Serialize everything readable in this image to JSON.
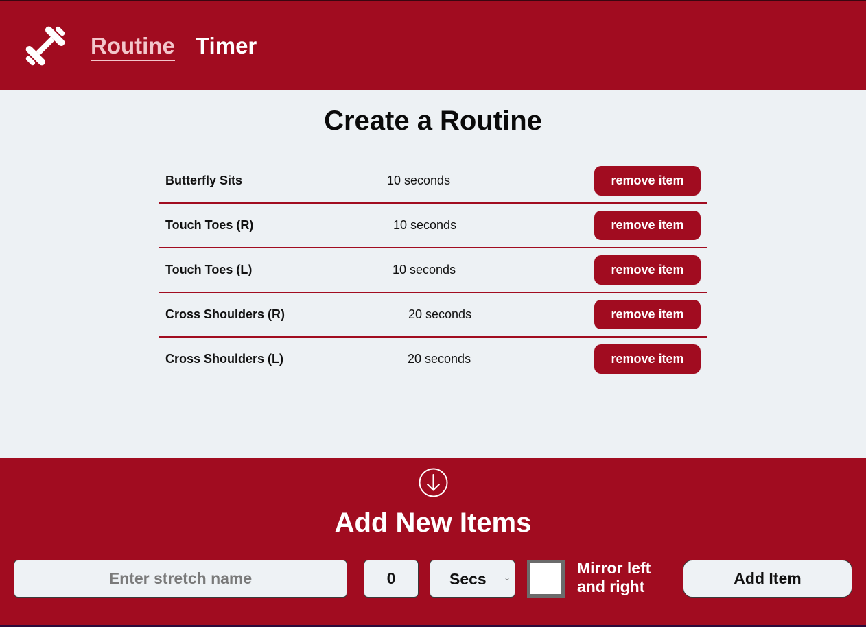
{
  "header": {
    "logo_icon": "dumbbell-icon",
    "nav": [
      {
        "label": "Routine",
        "active": true
      },
      {
        "label": "Timer",
        "active": false
      }
    ]
  },
  "main": {
    "title": "Create a Routine",
    "items": [
      {
        "name": "Butterfly Sits",
        "duration": "10 seconds",
        "action": "remove item"
      },
      {
        "name": "Touch Toes (R)",
        "duration": "10 seconds",
        "action": "remove item"
      },
      {
        "name": "Touch Toes (L)",
        "duration": "10 seconds",
        "action": "remove item"
      },
      {
        "name": "Cross Shoulders (R)",
        "duration": "20 seconds",
        "action": "remove item"
      },
      {
        "name": "Cross Shoulders (L)",
        "duration": "20 seconds",
        "action": "remove item"
      }
    ]
  },
  "footer": {
    "icon": "arrow-down-circle-icon",
    "title": "Add New Items",
    "stretch_placeholder": "Enter stretch name",
    "stretch_value": "",
    "quantity_value": "0",
    "unit_selected": "Secs",
    "mirror_label": "Mirror left and right",
    "mirror_checked": false,
    "add_label": "Add Item"
  },
  "colors": {
    "brand": "#a10c20",
    "background": "#edf1f4",
    "active_nav": "#f3c6cb"
  }
}
